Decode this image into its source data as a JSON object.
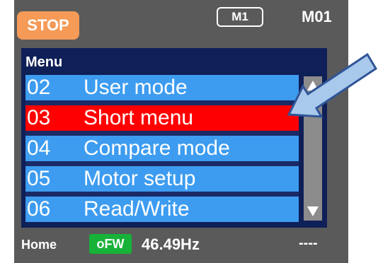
{
  "header": {
    "status": "STOP",
    "motor_select": "M1",
    "menu_code": "M01"
  },
  "menu": {
    "title": "Menu",
    "items": [
      {
        "num": "02",
        "label": "User mode",
        "selected": false
      },
      {
        "num": "03",
        "label": "Short menu",
        "selected": true
      },
      {
        "num": "04",
        "label": "Compare mode",
        "selected": false
      },
      {
        "num": "05",
        "label": "Motor setup",
        "selected": false
      },
      {
        "num": "06",
        "label": "Read/Write",
        "selected": false
      }
    ]
  },
  "footer": {
    "home": "Home",
    "badge": "oFW",
    "frequency": "46.49Hz",
    "right_value": "----"
  },
  "icons": {
    "scroll_up": "triangle-up-icon",
    "scroll_down": "triangle-down-icon",
    "pointer": "arrow-pointer-icon"
  },
  "colors": {
    "screen_bg": "#5a5a5a",
    "stop_badge": "#f59a57",
    "menu_frame": "#0f1f57",
    "item_bg": "#3d9cf0",
    "item_selected": "#ff0000",
    "ofw_badge": "#17b238",
    "scrollbar": "#8c8c8c",
    "arrow_fill": "#a9c9ec",
    "arrow_stroke": "#2f5597"
  }
}
